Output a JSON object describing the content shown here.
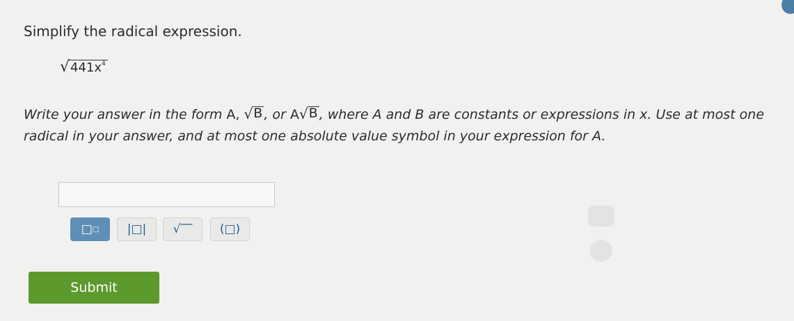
{
  "question": {
    "prompt": "Simplify the radical expression.",
    "expression": {
      "radicand": "441x",
      "exponent": "4"
    }
  },
  "instructions": {
    "part1": "Write your answer in the form ",
    "form_a": "A,",
    "form_b": "B",
    "part2": ", or ",
    "form_a2": "A",
    "form_b2": "B",
    "part3": ", where A and B are constants or expressions in x. Use at most one radical in your answer, and at most one absolute value symbol in your expression for A."
  },
  "answer": {
    "value": ""
  },
  "toolbar": {
    "superscript": "□",
    "superscript_exp": "□",
    "abs": "|□|",
    "sqrt": "√‾‾",
    "paren": "(□)"
  },
  "submit": {
    "label": "Submit"
  },
  "colors": {
    "submit_bg": "#5c9a2e",
    "tool_active": "#5f8fb7",
    "accent_text": "#1f5d8f"
  }
}
